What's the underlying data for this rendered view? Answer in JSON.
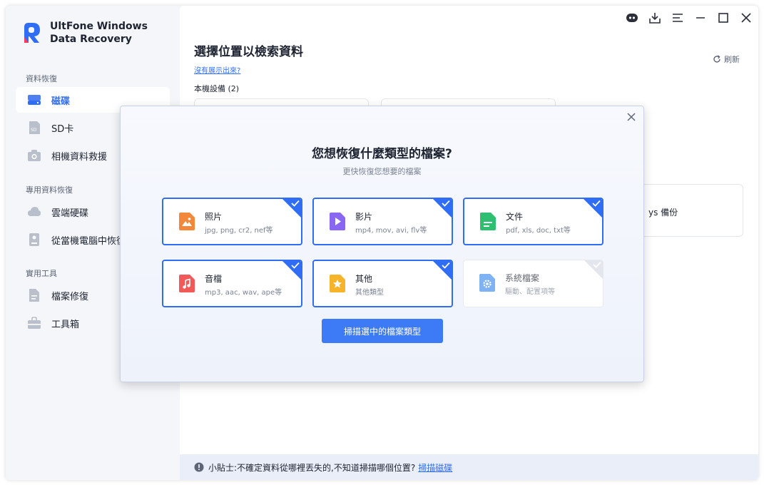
{
  "app": {
    "title_line1": "UltFone Windows",
    "title_line2": "Data Recovery"
  },
  "sidebar": {
    "sections": [
      {
        "title": "資料恢復"
      },
      {
        "title": "專用資料恢復"
      },
      {
        "title": "實用工具"
      }
    ],
    "items": [
      {
        "label": "磁碟",
        "icon": "disk-icon",
        "active": true
      },
      {
        "label": "SD卡",
        "icon": "sd-card-icon"
      },
      {
        "label": "相機資料救援",
        "icon": "camera-icon"
      },
      {
        "label": "雲端硬碟",
        "icon": "cloud-icon"
      },
      {
        "label": "從當機電腦中恢復",
        "icon": "crashed-computer-icon"
      },
      {
        "label": "檔案修復",
        "icon": "file-repair-icon"
      },
      {
        "label": "工具箱",
        "icon": "toolbox-icon"
      }
    ]
  },
  "main": {
    "title": "選擇位置以檢索資料",
    "missing_link": "沒有展示出來?",
    "refresh_label": "刷新",
    "local_devices_label": "本機設備 (2)",
    "side_card_text": "ys 備份"
  },
  "tip": {
    "text": "小貼士:不確定資料從哪裡丟失的,不知道掃描哪個位置?",
    "link": "掃描磁碟"
  },
  "dialog": {
    "title": "您想恢復什麼類型的檔案?",
    "subtitle": "更快恢復您想要的檔案",
    "types": [
      {
        "name": "照片",
        "desc": "jpg, png, cr2, nef等",
        "checked": true,
        "color": "#f4883a",
        "icon": "photo-icon"
      },
      {
        "name": "影片",
        "desc": "mp4, mov, avi, flv等",
        "checked": true,
        "color": "#8a67f2",
        "icon": "video-icon"
      },
      {
        "name": "文件",
        "desc": "pdf, xls, doc, txt等",
        "checked": true,
        "color": "#2fbf71",
        "icon": "document-icon"
      },
      {
        "name": "音檔",
        "desc": "mp3, aac, wav, ape等",
        "checked": true,
        "color": "#f25a5a",
        "icon": "audio-icon"
      },
      {
        "name": "其他",
        "desc": "其他類型",
        "checked": true,
        "color": "#f5b42a",
        "icon": "star-icon"
      },
      {
        "name": "系統檔案",
        "desc": "驅動、配置項等",
        "checked": false,
        "color": "#7fb2f2",
        "icon": "gear-icon"
      }
    ],
    "scan_button": "掃描選中的檔案類型"
  },
  "colors": {
    "accent": "#2f6df5",
    "button": "#3d7bf6",
    "sidebar_bg": "#f4f6fa",
    "tip_bg": "#e9eef9"
  }
}
